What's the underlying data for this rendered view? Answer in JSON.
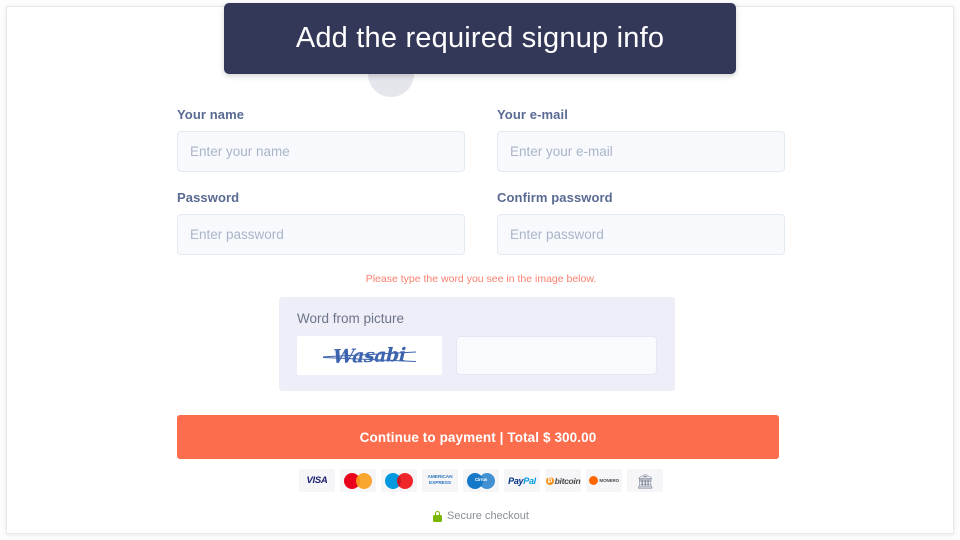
{
  "tooltip": {
    "text": "Add the required signup info",
    "background": "#343858",
    "text_color": "#ffffff"
  },
  "form": {
    "rows": [
      {
        "fields": [
          {
            "label": "Your name",
            "placeholder": "Enter your name",
            "value": "",
            "name": "name"
          },
          {
            "label": "Your e-mail",
            "placeholder": "Enter your e-mail",
            "value": "",
            "name": "email"
          }
        ]
      },
      {
        "fields": [
          {
            "label": "Password",
            "placeholder": "Enter password",
            "value": "",
            "name": "password"
          },
          {
            "label": "Confirm password",
            "placeholder": "Enter password",
            "value": "",
            "name": "confirm-password"
          }
        ]
      }
    ]
  },
  "captcha": {
    "error_message": "Please type the word you see in the image below.",
    "error_color": "#f98070",
    "label": "Word from picture",
    "word": "Wasabi",
    "word_color": "#3d63ae",
    "input_placeholder": "",
    "input_value": "",
    "panel_background": "#eeeef8"
  },
  "cta": {
    "label": "Continue to payment | Total $ 300.00",
    "background": "#fb6d4c",
    "text_color": "#ffffff"
  },
  "payment_methods": [
    {
      "name": "visa",
      "label": "VISA"
    },
    {
      "name": "mastercard",
      "label": "MasterCard"
    },
    {
      "name": "maestro",
      "label": "Maestro"
    },
    {
      "name": "american-express",
      "label_line1": "AMERICAN",
      "label_line2": "EXPRESS"
    },
    {
      "name": "cirrus",
      "label": "Cirrus"
    },
    {
      "name": "paypal",
      "label_a": "Pay",
      "label_b": "Pal"
    },
    {
      "name": "bitcoin",
      "mark": "₿",
      "label": "bitcoin"
    },
    {
      "name": "monero",
      "label": "MONERO"
    },
    {
      "name": "bank-transfer",
      "glyph": "🏛"
    }
  ],
  "footer": {
    "secure_text": "Secure checkout",
    "lock_color": "#7ab800"
  }
}
